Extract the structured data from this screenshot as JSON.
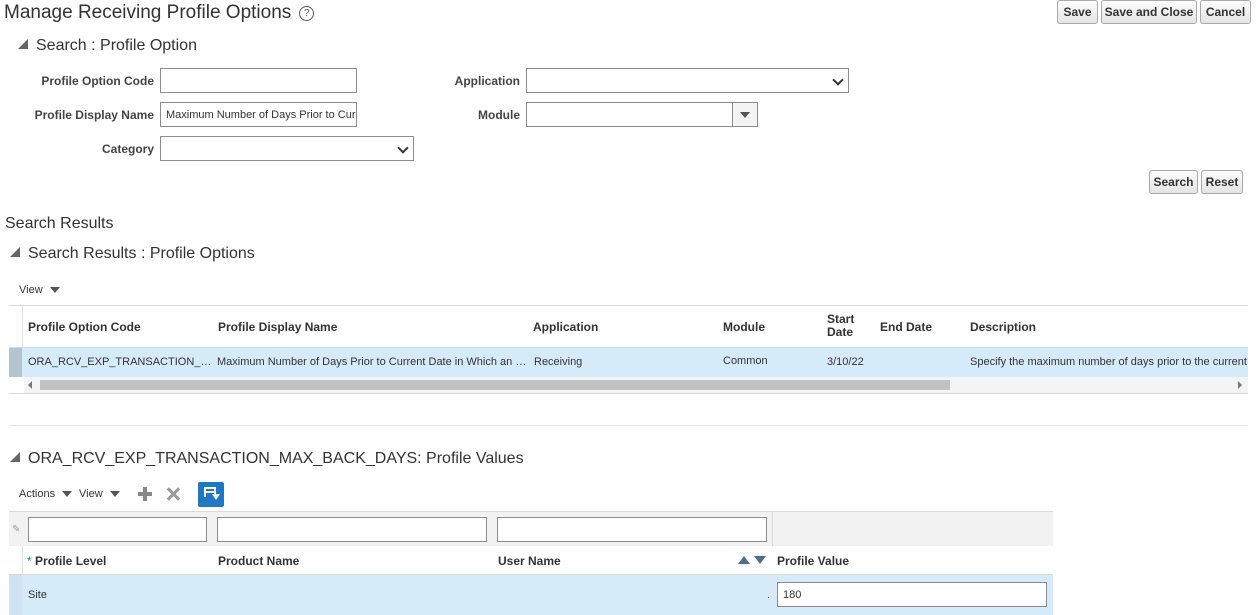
{
  "page": {
    "title": "Manage Receiving Profile Options",
    "help_icon": "?"
  },
  "header_buttons": {
    "save": "Save",
    "save_and_close": "Save and Close",
    "cancel": "Cancel"
  },
  "search": {
    "section_title": "Search : Profile Option",
    "profile_option_code_label": "Profile Option Code",
    "profile_option_code_value": "",
    "profile_display_name_label": "Profile Display Name",
    "profile_display_name_value": "Maximum Number of Days Prior to Cur",
    "category_label": "Category",
    "category_value": "",
    "application_label": "Application",
    "application_value": "",
    "module_label": "Module",
    "module_value": "",
    "search_button": "Search",
    "reset_button": "Reset"
  },
  "results": {
    "heading": "Search Results",
    "section_title": "Search Results : Profile Options",
    "view_menu": "View",
    "columns": {
      "code": "Profile Option Code",
      "display_name": "Profile Display Name",
      "application": "Application",
      "module": "Module",
      "start_date": "Start Date",
      "end_date": "End Date",
      "description": "Description"
    },
    "rows": [
      {
        "code": "ORA_RCV_EXP_TRANSACTION_…",
        "display_name": "Maximum Number of Days Prior to Current Date in Which an …",
        "application": "Receiving",
        "module": "Common",
        "start_date": "3/10/22",
        "end_date": "",
        "description": "Specify the maximum number of days prior to the current d"
      }
    ]
  },
  "values": {
    "section_title": "ORA_RCV_EXP_TRANSACTION_MAX_BACK_DAYS: Profile Values",
    "actions_menu": "Actions",
    "view_menu": "View",
    "required_marker": "*",
    "columns": {
      "profile_level": "Profile Level",
      "product_name": "Product Name",
      "user_name": "User Name",
      "profile_value": "Profile Value"
    },
    "filters": {
      "profile_level": "",
      "product_name": "",
      "user_name": ""
    },
    "rows": [
      {
        "profile_level": "Site",
        "product_name": "",
        "user_name": "",
        "dot": ".",
        "profile_value": "180"
      }
    ]
  },
  "colors": {
    "selected_row": "#d6ebf9",
    "accent_blue": "#1e78c2",
    "table_header_bg": "#f2f2f2"
  }
}
